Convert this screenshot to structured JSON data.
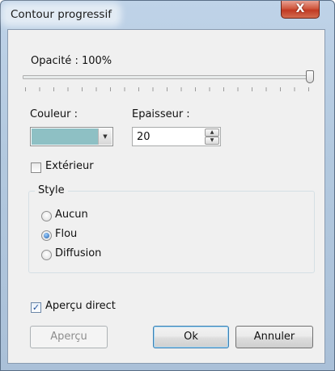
{
  "window": {
    "title": "Contour progressif",
    "close_glyph": "X"
  },
  "opacity": {
    "label": "Opacité : 100%",
    "value_percent": 100
  },
  "color": {
    "label": "Couleur :",
    "swatch": "#8ec0c4",
    "arrow_glyph": "▼"
  },
  "thickness": {
    "label": "Epaisseur :",
    "value": "20",
    "up_glyph": "▲",
    "down_glyph": "▼"
  },
  "exterior": {
    "label": "Extérieur",
    "checked": false
  },
  "style": {
    "title": "Style",
    "options": [
      {
        "label": "Aucun",
        "selected": false
      },
      {
        "label": "Flou",
        "selected": true
      },
      {
        "label": "Diffusion",
        "selected": false
      }
    ]
  },
  "live_preview": {
    "label": "Aperçu direct",
    "checked": true,
    "check_glyph": "✓"
  },
  "buttons": {
    "preview": "Aperçu",
    "ok": "Ok",
    "cancel": "Annuler"
  }
}
